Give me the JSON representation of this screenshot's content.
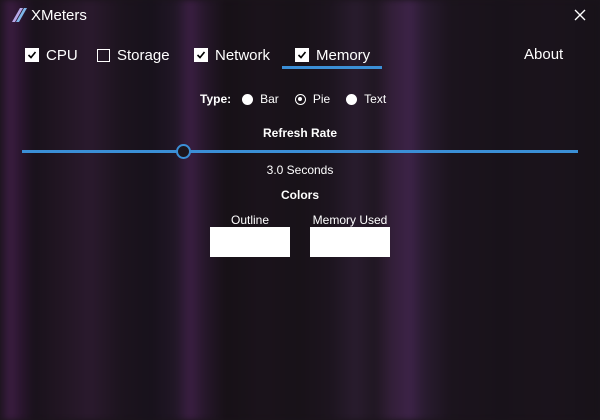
{
  "window": {
    "title": "XMeters",
    "logo_icon": "xmeters-logo-icon",
    "close_icon": "close-icon"
  },
  "tabs": [
    {
      "label": "CPU",
      "checked": true
    },
    {
      "label": "Storage",
      "checked": false
    },
    {
      "label": "Network",
      "checked": true
    },
    {
      "label": "Memory",
      "checked": true,
      "selected": true
    }
  ],
  "about_label": "About",
  "type": {
    "label": "Type:",
    "options": [
      {
        "label": "Bar",
        "selected": false
      },
      {
        "label": "Pie",
        "selected": true
      },
      {
        "label": "Text",
        "selected": false
      }
    ]
  },
  "refresh": {
    "title": "Refresh Rate",
    "value_text": "3.0 Seconds",
    "slider_fraction": 0.29
  },
  "colors": {
    "title": "Colors",
    "outline_label": "Outline",
    "outline_color": "#ffffff",
    "memory_used_label": "Memory Used",
    "memory_used_color": "#ffffff"
  },
  "accent_color": "#3b8fd6"
}
